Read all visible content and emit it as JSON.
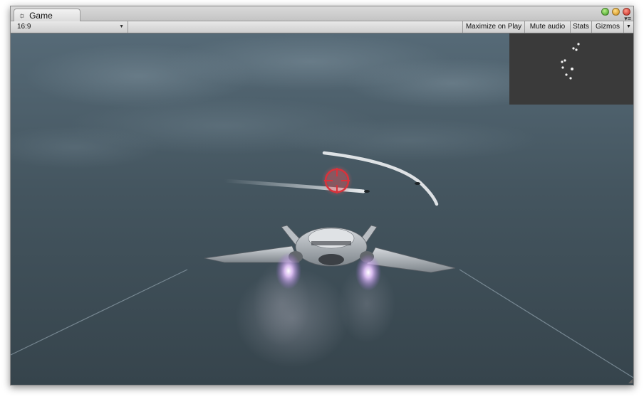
{
  "window": {
    "tab_label": "Game",
    "tab_icon": "unity-logo-icon"
  },
  "window_controls": [
    "zoom-green-button",
    "minimize-yellow-button",
    "close-red-button"
  ],
  "toolbar": {
    "aspect_value": "16:9",
    "buttons": [
      "Maximize on Play",
      "Mute audio",
      "Stats",
      "Gizmos"
    ]
  },
  "colors": {
    "sky": "#41525e",
    "crosshair": "#d9323b",
    "minimap_bg": "#3a3a3a",
    "toolbar": "#d6d6d6"
  },
  "scene": {
    "minimap_blips": 8,
    "enemy_ships": 2
  }
}
